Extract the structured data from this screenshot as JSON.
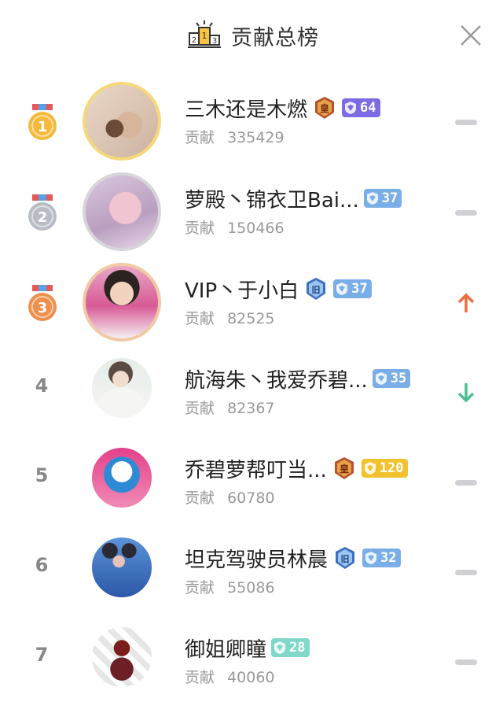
{
  "header": {
    "title": "贡献总榜",
    "podium_digits": [
      "2",
      "1",
      "3"
    ]
  },
  "contribution_label": "贡献",
  "users": [
    {
      "rank": "1",
      "name": "三木还是木燃",
      "contribution": "335429",
      "crown": true,
      "fan_badge": null,
      "level": "64",
      "level_color": "#7c6be4",
      "trend": "same"
    },
    {
      "rank": "2",
      "name": "萝殿丶锦衣卫Bai...",
      "contribution": "150466",
      "crown": false,
      "fan_badge": null,
      "level": "37",
      "level_color": "#7aaee8",
      "trend": "same"
    },
    {
      "rank": "3",
      "name": "VIP丶于小白",
      "contribution": "82525",
      "crown": false,
      "fan_badge": "旧",
      "level": "37",
      "level_color": "#7aaee8",
      "trend": "up"
    },
    {
      "rank": "4",
      "name": "航海朱丶我爱乔碧...",
      "contribution": "82367",
      "crown": false,
      "fan_badge": null,
      "level": "35",
      "level_color": "#7aaee8",
      "trend": "down"
    },
    {
      "rank": "5",
      "name": "乔碧萝帮叮当...",
      "contribution": "60780",
      "crown": true,
      "fan_badge": null,
      "level": "120",
      "level_color": "#f2c12e",
      "trend": "same"
    },
    {
      "rank": "6",
      "name": "坦克驾驶员林晨",
      "contribution": "55086",
      "crown": false,
      "fan_badge": "旧",
      "level": "32",
      "level_color": "#7aaee8",
      "trend": "same"
    },
    {
      "rank": "7",
      "name": "御姐卿瞳",
      "contribution": "40060",
      "crown": false,
      "fan_badge": null,
      "level": "28",
      "level_color": "#7fd8c8",
      "trend": "same"
    }
  ],
  "icons": {
    "close": "close-icon",
    "podium": "podium-icon",
    "medal": "medal-icon",
    "crown": "crown-icon",
    "trend_up": "arrow-up-icon",
    "trend_down": "arrow-down-icon",
    "trend_same": "dash-icon"
  },
  "colors": {
    "gold": "#f6b93b",
    "silver": "#b8bcc4",
    "bronze": "#ef8f4c",
    "up": "#ec6c3d",
    "down": "#4fbf93",
    "same": "#cfcfd4"
  }
}
